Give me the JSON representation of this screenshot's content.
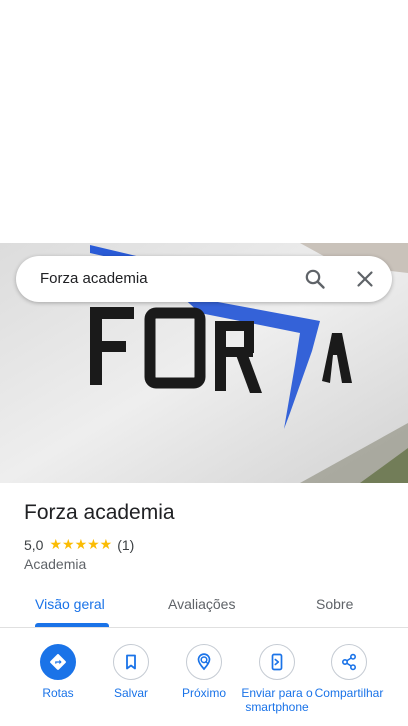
{
  "search": {
    "query": "Forza academia"
  },
  "place": {
    "name": "Forza academia",
    "rating": "5,0",
    "stars": "★★★★★",
    "review_count": "(1)",
    "category": "Academia"
  },
  "photo": {
    "wall_text": "FORZA"
  },
  "tabs": [
    {
      "label": "Visão geral",
      "active": true
    },
    {
      "label": "Avaliações",
      "active": false
    },
    {
      "label": "Sobre",
      "active": false
    }
  ],
  "actions": [
    {
      "label": "Rotas",
      "icon": "directions-icon"
    },
    {
      "label": "Salvar",
      "icon": "bookmark-icon"
    },
    {
      "label": "Próximo",
      "icon": "nearby-icon"
    },
    {
      "label": "Enviar para o smartphone",
      "icon": "send-to-phone-icon"
    },
    {
      "label": "Compartilhar",
      "icon": "share-icon"
    }
  ],
  "colors": {
    "accent": "#1a73e8",
    "star": "#fbbc04",
    "text": "#202124",
    "secondary": "#5f6368"
  }
}
